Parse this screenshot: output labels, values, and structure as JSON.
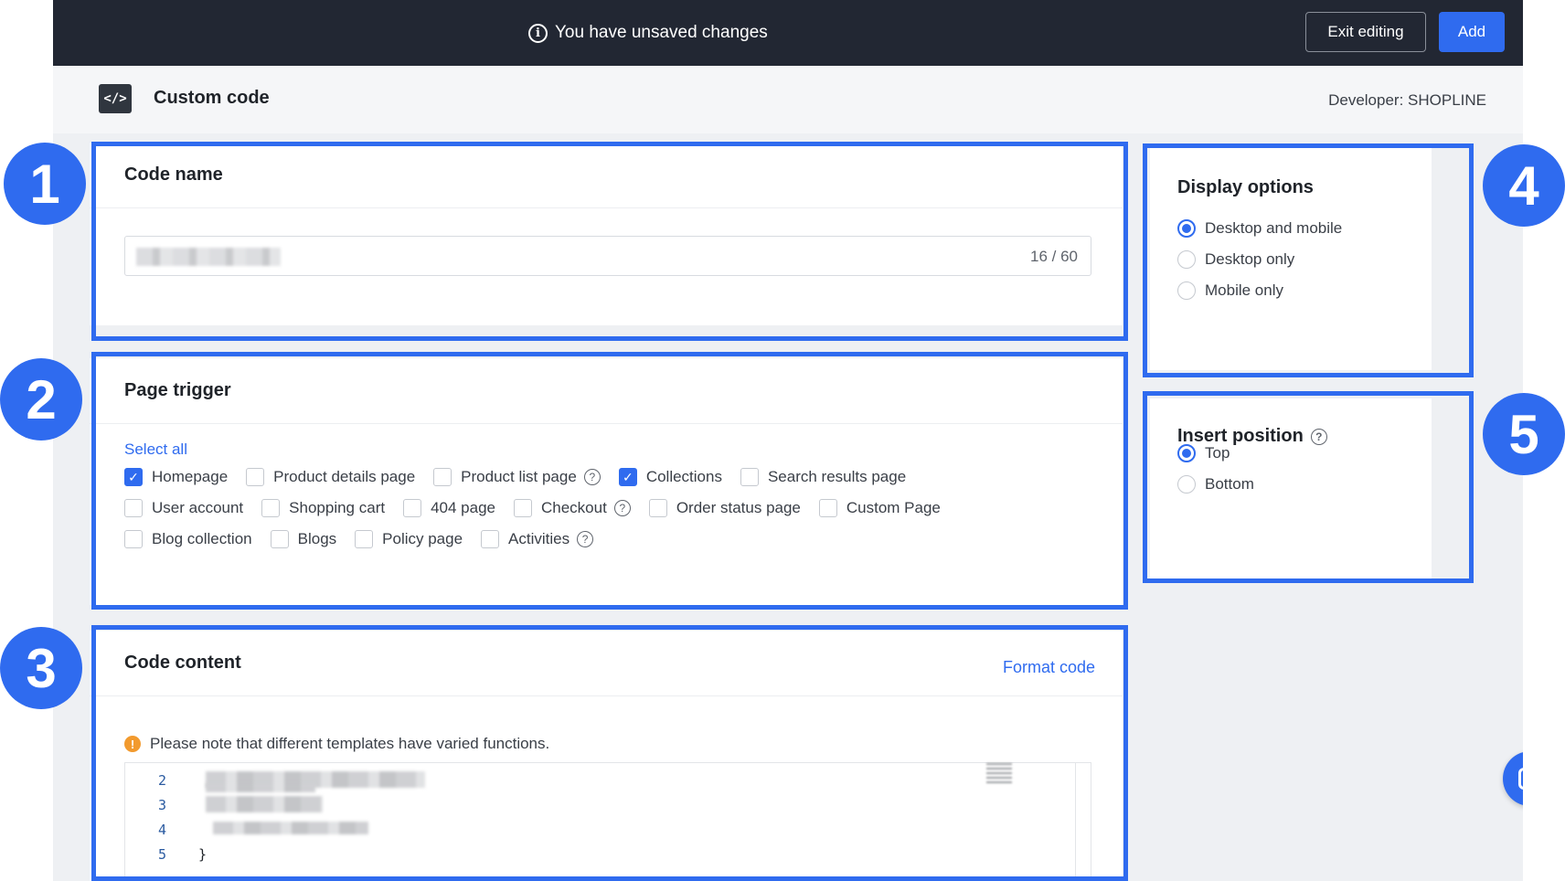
{
  "topbar": {
    "notice": "You have unsaved changes",
    "exit_label": "Exit editing",
    "add_label": "Add"
  },
  "app": {
    "icon_text": "</>",
    "title": "Custom code",
    "developer": "Developer: SHOPLINE"
  },
  "code_name": {
    "heading": "Code name",
    "counter": "16 / 60"
  },
  "page_trigger": {
    "heading": "Page trigger",
    "select_all": "Select all",
    "rows": [
      [
        {
          "label": "Homepage",
          "checked": true,
          "help": false
        },
        {
          "label": "Product details page",
          "checked": false,
          "help": false
        },
        {
          "label": "Product list page",
          "checked": false,
          "help": true
        },
        {
          "label": "Collections",
          "checked": true,
          "help": false
        },
        {
          "label": "Search results page",
          "checked": false,
          "help": false
        }
      ],
      [
        {
          "label": "User account",
          "checked": false,
          "help": false
        },
        {
          "label": "Shopping cart",
          "checked": false,
          "help": false
        },
        {
          "label": "404 page",
          "checked": false,
          "help": false
        },
        {
          "label": "Checkout",
          "checked": false,
          "help": true
        },
        {
          "label": "Order status page",
          "checked": false,
          "help": false
        },
        {
          "label": "Custom Page",
          "checked": false,
          "help": false
        }
      ],
      [
        {
          "label": "Blog collection",
          "checked": false,
          "help": false
        },
        {
          "label": "Blogs",
          "checked": false,
          "help": false
        },
        {
          "label": "Policy page",
          "checked": false,
          "help": false
        },
        {
          "label": "Activities",
          "checked": false,
          "help": true
        }
      ]
    ]
  },
  "code_content": {
    "heading": "Code content",
    "format_label": "Format code",
    "warning": "Please note that different templates have varied functions.",
    "line_numbers": [
      "2",
      "3",
      "4",
      "5"
    ],
    "closing_brace": "}"
  },
  "display_options": {
    "heading": "Display options",
    "options": [
      {
        "label": "Desktop and mobile",
        "selected": true
      },
      {
        "label": "Desktop only",
        "selected": false
      },
      {
        "label": "Mobile only",
        "selected": false
      }
    ]
  },
  "insert_position": {
    "heading": "Insert position",
    "options": [
      {
        "label": "Top",
        "selected": true
      },
      {
        "label": "Bottom",
        "selected": false
      }
    ]
  },
  "badges": [
    "1",
    "2",
    "3",
    "4",
    "5"
  ],
  "colors": {
    "accent": "#2f6bef",
    "topbar": "#222733",
    "warning": "#f29a2e"
  }
}
